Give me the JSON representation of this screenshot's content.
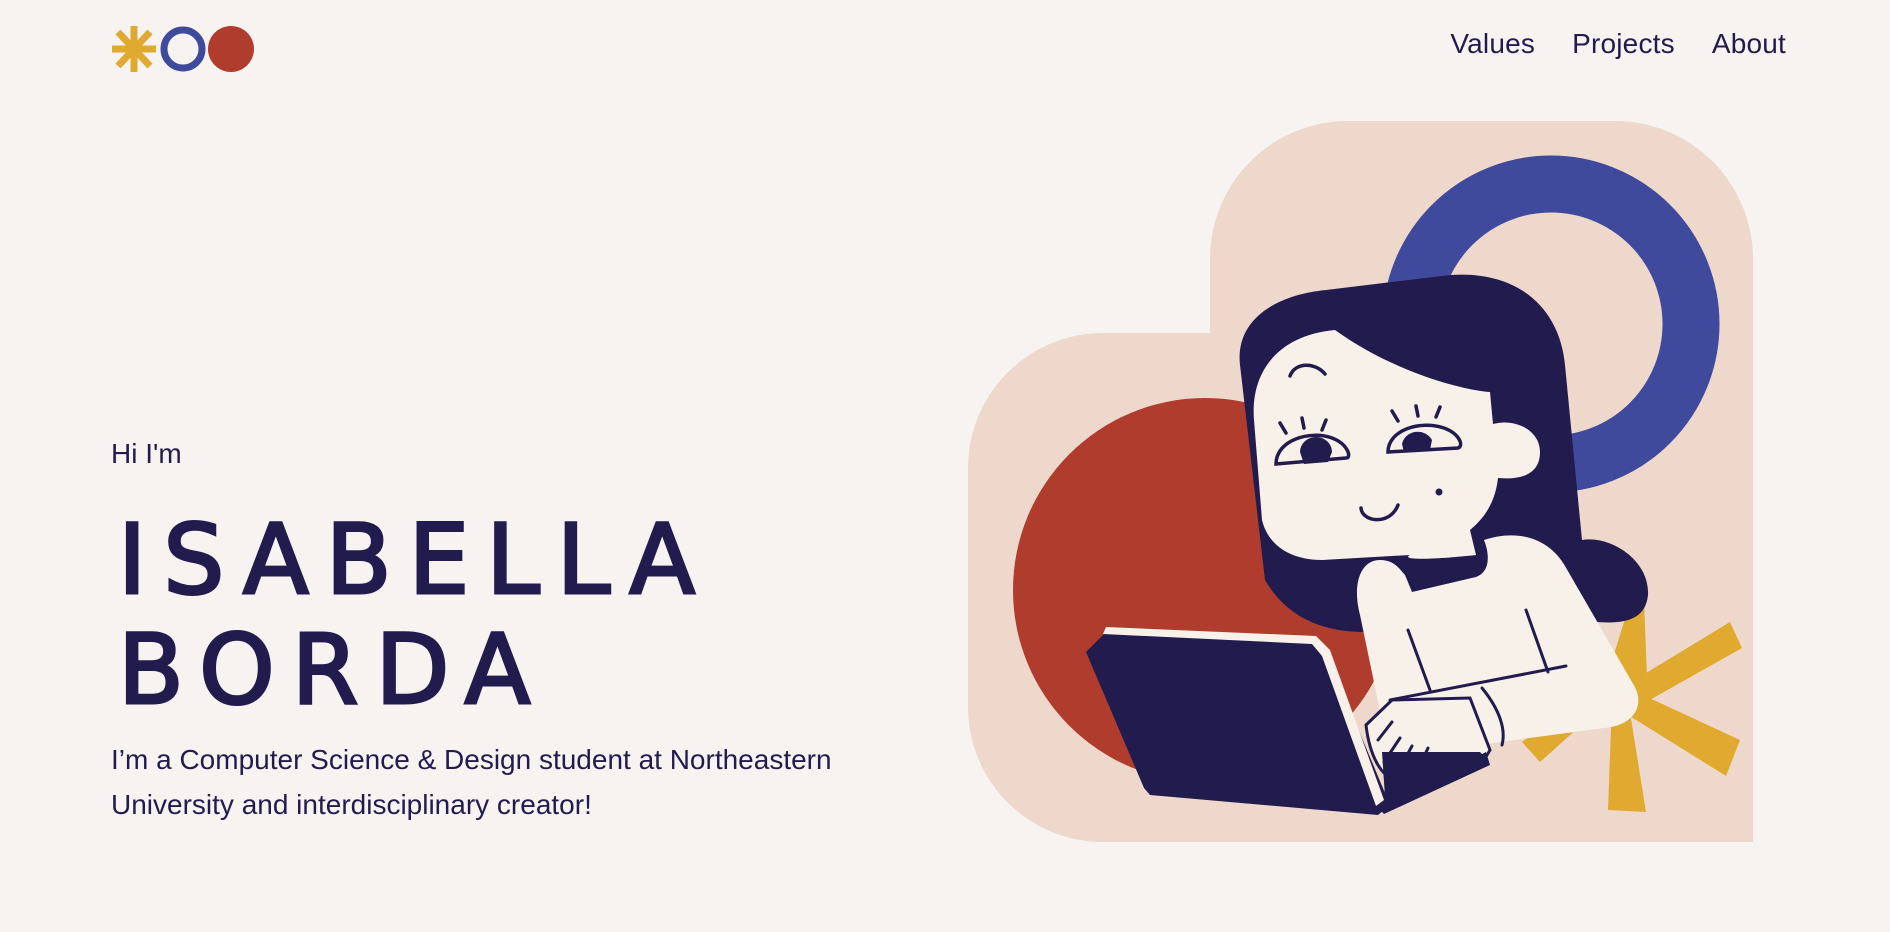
{
  "header": {
    "logo_icons": [
      "asterisk-icon",
      "ring-icon",
      "dot-icon"
    ],
    "nav": [
      {
        "label": "Values"
      },
      {
        "label": "Projects"
      },
      {
        "label": "About"
      }
    ]
  },
  "hero": {
    "greeting": "Hi I'm",
    "name_line1": "ISABELLA",
    "name_line2": "BORDA",
    "bio": "I’m a Computer Science & Design student at Northeastern University and interdisciplinary creator!"
  },
  "colors": {
    "background": "#f7f3f0",
    "navy": "#221c4e",
    "blue": "#3f4a9c",
    "red": "#b03c2e",
    "yellow": "#e0a92f",
    "peach": "#eed8cc",
    "cream": "#f7f1ea"
  }
}
